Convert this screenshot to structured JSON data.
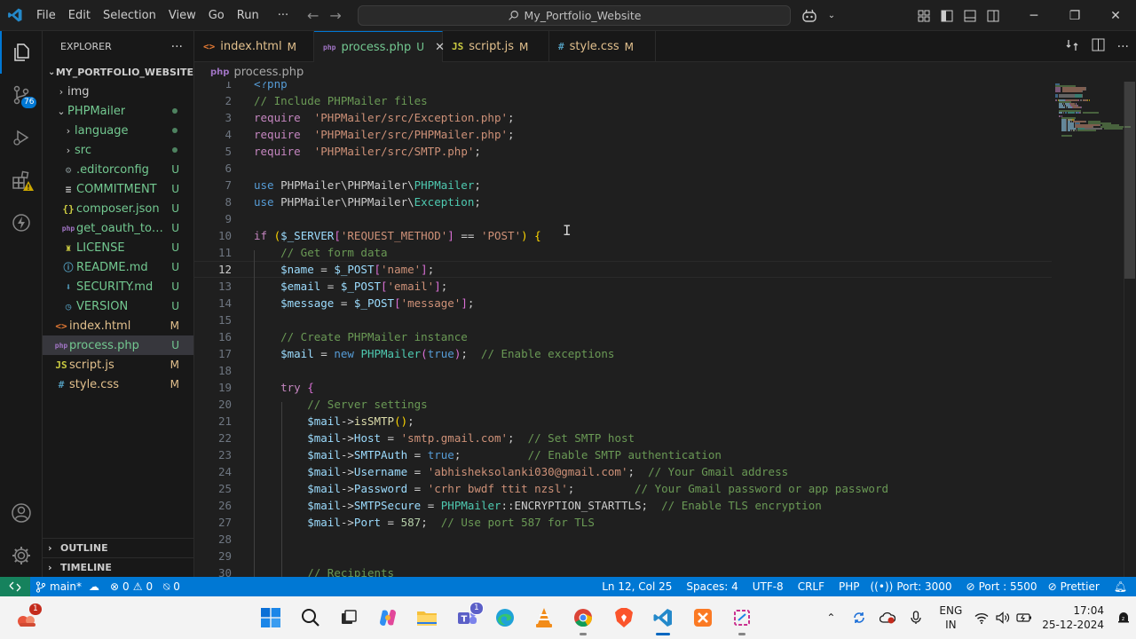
{
  "titlebar": {
    "menus": [
      "File",
      "Edit",
      "Selection",
      "View",
      "Go",
      "Run",
      "···"
    ],
    "search": "My_Portfolio_Website"
  },
  "activity": {
    "scm_badge": "76"
  },
  "sidebar": {
    "title": "EXPLORER",
    "more": "···",
    "root": "MY_PORTFOLIO_WEBSITE",
    "items": [
      {
        "name": "img",
        "type": "folder",
        "depth": 1,
        "status": ""
      },
      {
        "name": "PHPMailer",
        "type": "folder-open",
        "depth": 1,
        "status": "dot"
      },
      {
        "name": "language",
        "type": "folder",
        "depth": 2,
        "status": "dot"
      },
      {
        "name": "src",
        "type": "folder",
        "depth": 2,
        "status": "dot"
      },
      {
        "name": ".editorconfig",
        "type": "gear",
        "depth": 2,
        "status": "U"
      },
      {
        "name": "COMMITMENT",
        "type": "lines",
        "depth": 2,
        "status": "U"
      },
      {
        "name": "composer.json",
        "type": "json",
        "depth": 2,
        "status": "U"
      },
      {
        "name": "get_oauth_toke...",
        "type": "php",
        "depth": 2,
        "status": "U"
      },
      {
        "name": "LICENSE",
        "type": "license",
        "depth": 2,
        "status": "U"
      },
      {
        "name": "README.md",
        "type": "info",
        "depth": 2,
        "status": "U"
      },
      {
        "name": "SECURITY.md",
        "type": "md",
        "depth": 2,
        "status": "U"
      },
      {
        "name": "VERSION",
        "type": "clock",
        "depth": 2,
        "status": "U"
      },
      {
        "name": "index.html",
        "type": "html",
        "depth": 1,
        "status": "M"
      },
      {
        "name": "process.php",
        "type": "php",
        "depth": 1,
        "status": "U"
      },
      {
        "name": "script.js",
        "type": "js",
        "depth": 1,
        "status": "M"
      },
      {
        "name": "style.css",
        "type": "css",
        "depth": 1,
        "status": "M"
      }
    ],
    "outline": "OUTLINE",
    "timeline": "TIMELINE"
  },
  "tabs": [
    {
      "label": "index.html",
      "icon": "<>",
      "status": "M",
      "active": false
    },
    {
      "label": "process.php",
      "icon": "php",
      "status": "U",
      "active": true
    },
    {
      "label": "script.js",
      "icon": "JS",
      "status": "M",
      "active": false
    },
    {
      "label": "style.css",
      "icon": "#",
      "status": "M",
      "active": false
    }
  ],
  "breadcrumb": "process.php",
  "code_lines": [
    [
      [
        "k",
        "&lt;?php"
      ]
    ],
    [
      [
        "c",
        "// Include PHPMailer files"
      ]
    ],
    [
      [
        "cf",
        "require"
      ],
      [
        "",
        "  "
      ],
      [
        "s",
        "'PHPMailer/src/Exception.php'"
      ],
      [
        "",
        ";"
      ]
    ],
    [
      [
        "cf",
        "require"
      ],
      [
        "",
        "  "
      ],
      [
        "s",
        "'PHPMailer/src/PHPMailer.php'"
      ],
      [
        "",
        ";"
      ]
    ],
    [
      [
        "cf",
        "require"
      ],
      [
        "",
        "  "
      ],
      [
        "s",
        "'PHPMailer/src/SMTP.php'"
      ],
      [
        "",
        ";"
      ]
    ],
    [],
    [
      [
        "k",
        "use"
      ],
      [
        "",
        " PHPMailer\\PHPMailer\\"
      ],
      [
        "t",
        "PHPMailer"
      ],
      [
        "",
        ";"
      ]
    ],
    [
      [
        "k",
        "use"
      ],
      [
        "",
        " PHPMailer\\PHPMailer\\"
      ],
      [
        "t",
        "Exception"
      ],
      [
        "",
        ";"
      ]
    ],
    [],
    [
      [
        "cf",
        "if"
      ],
      [
        "",
        " "
      ],
      [
        "b1",
        "("
      ],
      [
        "v",
        "$_SERVER"
      ],
      [
        "p",
        "["
      ],
      [
        "s",
        "'REQUEST_METHOD'"
      ],
      [
        "p",
        "]"
      ],
      [
        "",
        " == "
      ],
      [
        "s",
        "'POST'"
      ],
      [
        "b1",
        ")"
      ],
      [
        "",
        " "
      ],
      [
        "b1",
        "{"
      ]
    ],
    [
      [
        "",
        "    "
      ],
      [
        "c",
        "// Get form data"
      ]
    ],
    [
      [
        "",
        "    "
      ],
      [
        "v",
        "$name"
      ],
      [
        "",
        " = "
      ],
      [
        "v",
        "$_POST"
      ],
      [
        "p",
        "["
      ],
      [
        "s",
        "'name'"
      ],
      [
        "p",
        "]"
      ],
      [
        "",
        ";"
      ]
    ],
    [
      [
        "",
        "    "
      ],
      [
        "v",
        "$email"
      ],
      [
        "",
        " = "
      ],
      [
        "v",
        "$_POST"
      ],
      [
        "p",
        "["
      ],
      [
        "s",
        "'email'"
      ],
      [
        "p",
        "]"
      ],
      [
        "",
        ";"
      ]
    ],
    [
      [
        "",
        "    "
      ],
      [
        "v",
        "$message"
      ],
      [
        "",
        " = "
      ],
      [
        "v",
        "$_POST"
      ],
      [
        "p",
        "["
      ],
      [
        "s",
        "'message'"
      ],
      [
        "p",
        "]"
      ],
      [
        "",
        ";"
      ]
    ],
    [],
    [
      [
        "",
        "    "
      ],
      [
        "c",
        "// Create PHPMailer instance"
      ]
    ],
    [
      [
        "",
        "    "
      ],
      [
        "v",
        "$mail"
      ],
      [
        "",
        " = "
      ],
      [
        "k",
        "new"
      ],
      [
        "",
        " "
      ],
      [
        "t",
        "PHPMailer"
      ],
      [
        "p",
        "("
      ],
      [
        "k",
        "true"
      ],
      [
        "p",
        ")"
      ],
      [
        "",
        ";  "
      ],
      [
        "c",
        "// Enable exceptions"
      ]
    ],
    [],
    [
      [
        "",
        "    "
      ],
      [
        "cf",
        "try"
      ],
      [
        "",
        " "
      ],
      [
        "p",
        "{"
      ]
    ],
    [
      [
        "",
        "        "
      ],
      [
        "c",
        "// Server settings"
      ]
    ],
    [
      [
        "",
        "        "
      ],
      [
        "v",
        "$mail"
      ],
      [
        "",
        "->"
      ],
      [
        "f",
        "isSMTP"
      ],
      [
        "b1",
        "()"
      ],
      [
        "",
        ";"
      ]
    ],
    [
      [
        "",
        "        "
      ],
      [
        "v",
        "$mail"
      ],
      [
        "",
        "->"
      ],
      [
        "v",
        "Host"
      ],
      [
        "",
        " = "
      ],
      [
        "s",
        "'smtp.gmail.com'"
      ],
      [
        "",
        ";  "
      ],
      [
        "c",
        "// Set SMTP host"
      ]
    ],
    [
      [
        "",
        "        "
      ],
      [
        "v",
        "$mail"
      ],
      [
        "",
        "->"
      ],
      [
        "v",
        "SMTPAuth"
      ],
      [
        "",
        " = "
      ],
      [
        "k",
        "true"
      ],
      [
        "",
        ";          "
      ],
      [
        "c",
        "// Enable SMTP authentication"
      ]
    ],
    [
      [
        "",
        "        "
      ],
      [
        "v",
        "$mail"
      ],
      [
        "",
        "->"
      ],
      [
        "v",
        "Username"
      ],
      [
        "",
        " = "
      ],
      [
        "s",
        "'abhisheksolanki030@gmail.com'"
      ],
      [
        "",
        ";  "
      ],
      [
        "c",
        "// Your Gmail address"
      ]
    ],
    [
      [
        "",
        "        "
      ],
      [
        "v",
        "$mail"
      ],
      [
        "",
        "->"
      ],
      [
        "v",
        "Password"
      ],
      [
        "",
        " = "
      ],
      [
        "s",
        "'crhr bwdf ttit nzsl'"
      ],
      [
        "",
        ";         "
      ],
      [
        "c",
        "// Your Gmail password or app password"
      ]
    ],
    [
      [
        "",
        "        "
      ],
      [
        "v",
        "$mail"
      ],
      [
        "",
        "->"
      ],
      [
        "v",
        "SMTPSecure"
      ],
      [
        "",
        " = "
      ],
      [
        "t",
        "PHPMailer"
      ],
      [
        "",
        "::ENCRYPTION_STARTTLS;  "
      ],
      [
        "c",
        "// Enable TLS encryption"
      ]
    ],
    [
      [
        "",
        "        "
      ],
      [
        "v",
        "$mail"
      ],
      [
        "",
        "->"
      ],
      [
        "v",
        "Port"
      ],
      [
        "",
        " = "
      ],
      [
        "n",
        "587"
      ],
      [
        "",
        ";  "
      ],
      [
        "c",
        "// Use port 587 for TLS"
      ]
    ],
    [],
    [],
    [
      [
        "",
        "        "
      ],
      [
        "c",
        "// Recipients"
      ]
    ]
  ],
  "current_line": 12,
  "statusbar": {
    "branch": "main*",
    "errors": "0",
    "warnings": "0",
    "ports": "0",
    "position": "Ln 12, Col 25",
    "spaces": "Spaces: 4",
    "encoding": "UTF-8",
    "eol": "CRLF",
    "language": "PHP",
    "port_server": "Port: 3000",
    "port_live": "Port : 5500",
    "prettier": "Prettier"
  },
  "taskbar": {
    "notif_badge": "1",
    "teams_badge": "1",
    "lang_top": "ENG",
    "lang_bottom": "IN",
    "time": "17:04",
    "date": "25-12-2024"
  }
}
